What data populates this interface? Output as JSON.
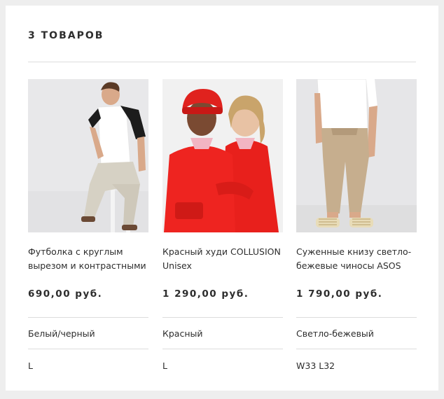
{
  "header": {
    "title": "3 ТОВАРОВ"
  },
  "products": [
    {
      "name": "Футболка с круглым вырезом и контрастными",
      "price": "690,00 руб.",
      "color": "Белый/черный",
      "size": "L",
      "image": "man-in-raglan-tshirt-sitting"
    },
    {
      "name": "Красный худи COLLUSION Unisex",
      "price": "1 290,00 руб.",
      "color": "Красный",
      "size": "L",
      "image": "couple-in-red-hoodies"
    },
    {
      "name": "Суженные книзу светло-бежевые чиносы ASOS",
      "price": "1 790,00 руб.",
      "color": "Светло-бежевый",
      "size": "W33 L32",
      "image": "man-in-beige-chinos"
    }
  ]
}
